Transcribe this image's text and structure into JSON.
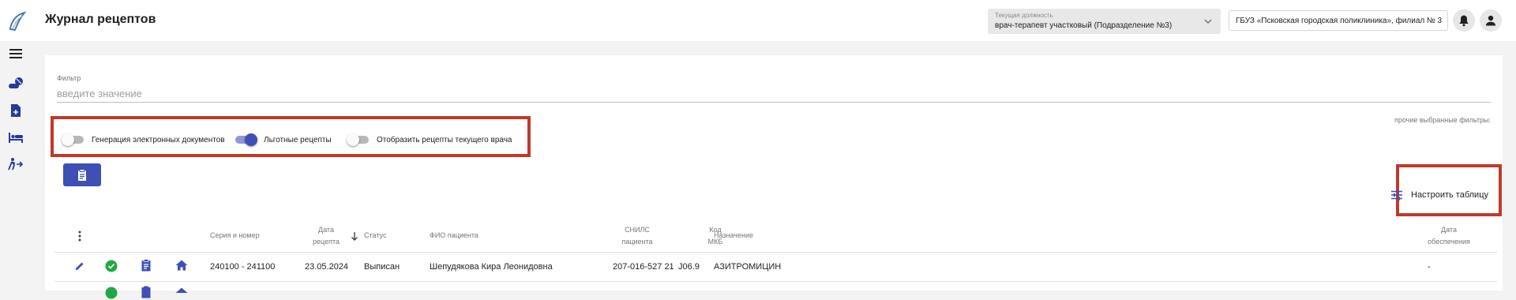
{
  "header": {
    "app_title": "Журнал рецептов",
    "position": {
      "label": "Текущая должность",
      "value": "врач-терапевт участковый (Подразделение №3)"
    },
    "organization": "ГБУЗ «Псковская городская поликлиника», филиал № 3"
  },
  "icons": {
    "logo": "logo-icon",
    "menu": "hamburger-menu-icon",
    "notifications": "bell-icon",
    "account": "user-account-icon",
    "sidebar": [
      "pills-icon",
      "file-plus-icon",
      "hospital-bed-icon",
      "patient-transfer-icon"
    ]
  },
  "filter": {
    "label": "Фильтр",
    "placeholder": "введите значение",
    "other_filters": "прочие выбранные фильтры:"
  },
  "toggles": [
    {
      "label": "Генерация электронных документов",
      "on": false
    },
    {
      "label": "Льготные рецепты",
      "on": true
    },
    {
      "label": "Отобразить рецепты текущего врача",
      "on": false
    }
  ],
  "actions": {
    "clipboard_button": "clipboard-icon",
    "table_settings_label": "Настроить таблицу"
  },
  "table": {
    "headers": {
      "series_number": "Серия и номер",
      "recipe_date_line1": "Дата",
      "recipe_date_line2": "рецепта",
      "status": "Статус",
      "patient_name": "ФИО пациента",
      "snils_line1": "СНИЛС",
      "snils_line2": "пациента",
      "mkb_line1": "Код",
      "mkb_line2": "МКБ",
      "prescription": "Назначение",
      "supply_date_line1": "Дата",
      "supply_date_line2": "обеспечения"
    },
    "rows": [
      {
        "series_number": "240100 - 241100",
        "recipe_date": "23.05.2024",
        "status": "Выписан",
        "patient_name": "Шепудякова Кира Леонидовна",
        "snils": "207-016-527 21",
        "mkb": "J06.9",
        "prescription": "АЗИТРОМИЦИН",
        "supply_date": "-"
      }
    ]
  },
  "colors": {
    "primary": "#3f4fb5",
    "success": "#1fa845",
    "highlight_frame": "#c0392b"
  }
}
